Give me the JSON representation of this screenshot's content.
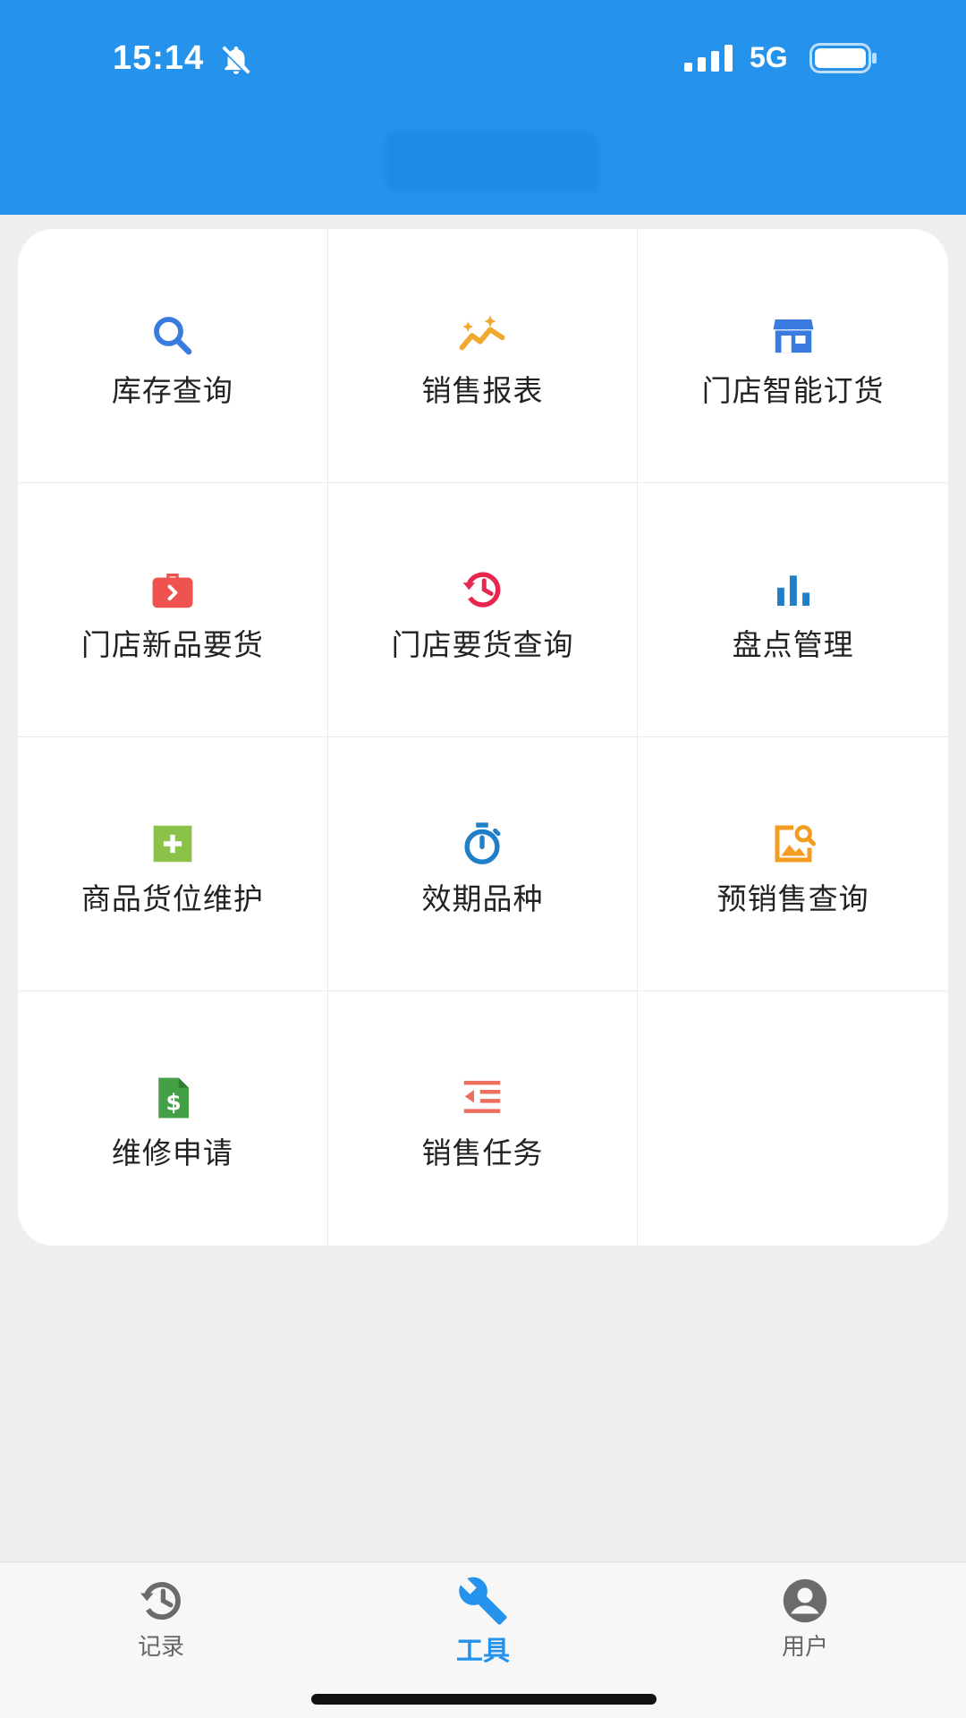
{
  "status_bar": {
    "time": "15:14",
    "network": "5G"
  },
  "menu": {
    "items": [
      {
        "label": "库存查询",
        "icon": "search-icon"
      },
      {
        "label": "销售报表",
        "icon": "sales-trend-icon"
      },
      {
        "label": "门店智能订货",
        "icon": "store-icon"
      },
      {
        "label": "门店新品要货",
        "icon": "briefcase-icon"
      },
      {
        "label": "门店要货查询",
        "icon": "history-icon"
      },
      {
        "label": "盘点管理",
        "icon": "bar-chart-icon"
      },
      {
        "label": "商品货位维护",
        "icon": "add-box-icon"
      },
      {
        "label": "效期品种",
        "icon": "stopwatch-icon"
      },
      {
        "label": "预销售查询",
        "icon": "image-search-icon"
      },
      {
        "label": "维修申请",
        "icon": "invoice-icon"
      },
      {
        "label": "销售任务",
        "icon": "indent-list-icon"
      }
    ]
  },
  "tabs": [
    {
      "label": "记录",
      "icon": "history-icon"
    },
    {
      "label": "工具",
      "icon": "wrench-icon"
    },
    {
      "label": "用户",
      "icon": "account-icon"
    }
  ],
  "colors": {
    "header": "#2592ec",
    "search": "#3a7be0",
    "sales": "#f0a830",
    "store": "#3a7be0",
    "briefcase": "#ef5350",
    "history": "#e8264e",
    "bars": "#1f7fc8",
    "addbox": "#8bc34a",
    "stopwatch": "#1f7fc8",
    "imagesearch": "#f39c1f",
    "invoice": "#43a047",
    "indent": "#ef6f5f",
    "tab_active": "#2592ec",
    "tab_inactive": "#666666"
  }
}
